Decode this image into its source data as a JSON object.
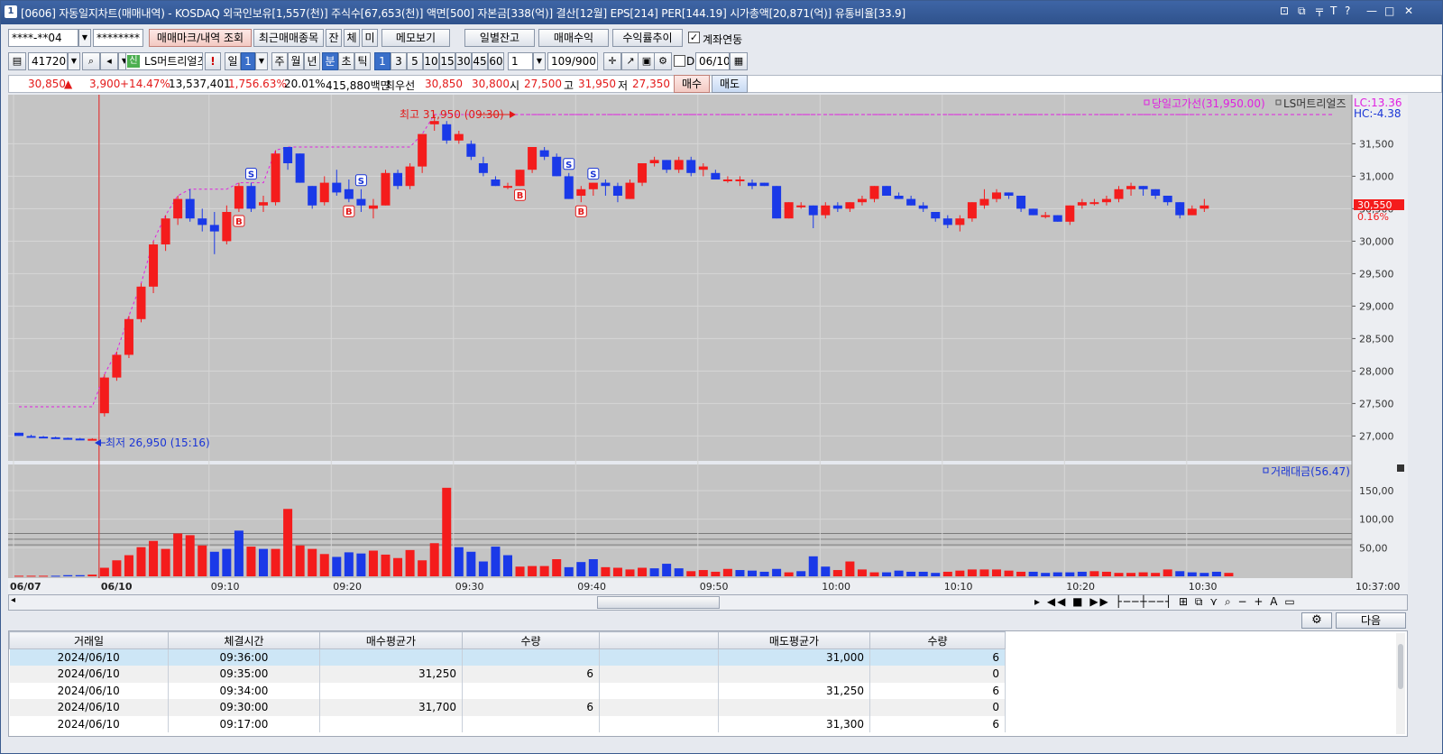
{
  "window": {
    "number": "1",
    "title": "[0606] 자동일지차트(매매내역) - KOSDAQ 외국인보유[1,557(천)] 주식수[67,653(천)] 액면[500] 자본금[338(억)] 결산[12월] EPS[214] PER[144.19] 시가총액[20,871(억)] 유통비율[33.9]",
    "controls": [
      "⊡",
      "⧉",
      "〒",
      "T",
      "?",
      "—",
      "□",
      "✕"
    ]
  },
  "toolbar1": {
    "account": "****-**04",
    "password": "********",
    "btn_trade_mark": "매매마크/내역 조회",
    "btn_recent": "최근매매종목",
    "btn_jan": "잔",
    "btn_che": "체",
    "btn_mi": "미",
    "btn_memo": "메모보기",
    "btn_daily_balance": "일별잔고",
    "btn_trade_profit": "매매수익",
    "btn_return_trend": "수익률추이",
    "account_link_label": "계좌연동"
  },
  "toolbar2": {
    "code": "417200",
    "badge": "신",
    "name": "LS머트리얼즈",
    "excl": "!",
    "period_label": "일",
    "period_value": "1",
    "periods": [
      "주",
      "월",
      "년",
      "분",
      "초",
      "틱"
    ],
    "intervals": [
      "1",
      "3",
      "5",
      "10",
      "15",
      "30",
      "45",
      "60"
    ],
    "custom_interval": "1",
    "count": "109/900",
    "date_checkbox": "D",
    "date": "06/10"
  },
  "info": {
    "price": "30,850",
    "arrow": "▲",
    "change": "3,900",
    "change_pct": "+14.47%",
    "volume": "13,537,401",
    "volume_pct": "1,756.63%",
    "turnover": "20.01%",
    "amount": "415,880백만",
    "quote_label": "최우선",
    "ask": "30,850",
    "bid": "30,800",
    "open_label": "시",
    "open": "27,500",
    "high_label": "고",
    "high": "31,950",
    "low_label": "저",
    "low": "27,350",
    "buy_btn": "매수",
    "sell_btn": "매도"
  },
  "chart_data": {
    "type": "candlestick",
    "price_axis": {
      "min": 26700,
      "max": 32200,
      "ticks": [
        27000,
        27500,
        28000,
        28500,
        29000,
        29500,
        30000,
        30500,
        31000,
        31500
      ]
    },
    "price_tick_labels": [
      "27,000",
      "27,500",
      "28,000",
      "28,500",
      "29,000",
      "29,500",
      "30,000",
      "30,500",
      "31,000",
      "31,500"
    ],
    "volume_axis": {
      "min": 0,
      "max": 180,
      "ticks": [
        50,
        100,
        150
      ]
    },
    "volume_tick_labels": [
      "50,00",
      "100,00",
      "150,00"
    ],
    "x_labels": [
      "06/07",
      "06/10",
      "09:10",
      "09:20",
      "09:30",
      "09:40",
      "09:50",
      "10:00",
      "10:10",
      "10:20",
      "10:30",
      "10:37:00"
    ],
    "annotations": {
      "high": "최고 31,950 (09:30)",
      "low": "최저 26,950 (15:16)",
      "prev_high_line": "당일고가선(31,950.00)",
      "series_name": "LS머트리얼즈",
      "lc": "LC:13.36",
      "hc": "HC:-4.38",
      "current_price": "30,550",
      "current_pct": "0.16%",
      "volume_series": "거래대금(56.47)"
    },
    "trade_marks": [
      "B",
      "S",
      "B",
      "S",
      "B",
      "S",
      "B",
      "S"
    ],
    "candles": [
      [
        27050,
        27050,
        27000,
        27000
      ],
      [
        27000,
        27020,
        26980,
        26990
      ],
      [
        26990,
        27000,
        26970,
        26980
      ],
      [
        26980,
        26990,
        26960,
        26970
      ],
      [
        26970,
        26975,
        26955,
        26960
      ],
      [
        26960,
        26970,
        26950,
        26955
      ],
      [
        26955,
        26965,
        26950,
        26955
      ],
      [
        27350,
        27950,
        27300,
        27900
      ],
      [
        27900,
        28300,
        27850,
        28250
      ],
      [
        28250,
        28850,
        28200,
        28800
      ],
      [
        28800,
        29350,
        28750,
        29300
      ],
      [
        29300,
        30000,
        29200,
        29950
      ],
      [
        29950,
        30400,
        29850,
        30350
      ],
      [
        30350,
        30700,
        30250,
        30650
      ],
      [
        30650,
        30800,
        30300,
        30350
      ],
      [
        30350,
        30500,
        30150,
        30250
      ],
      [
        30250,
        30450,
        29800,
        30150
      ],
      [
        30000,
        30550,
        29950,
        30450
      ],
      [
        30500,
        30900,
        30450,
        30850
      ],
      [
        30850,
        30900,
        30450,
        30500
      ],
      [
        30550,
        30700,
        30450,
        30600
      ],
      [
        30600,
        31400,
        30550,
        31350
      ],
      [
        31450,
        31450,
        31100,
        31200
      ],
      [
        31350,
        31350,
        30900,
        30900
      ],
      [
        30850,
        30850,
        30500,
        30550
      ],
      [
        30600,
        31000,
        30550,
        30900
      ],
      [
        30900,
        31100,
        30700,
        30750
      ],
      [
        30800,
        30950,
        30600,
        30650
      ],
      [
        30650,
        30800,
        30450,
        30550
      ],
      [
        30500,
        30650,
        30350,
        30550
      ],
      [
        30550,
        31100,
        30550,
        31050
      ],
      [
        31050,
        31100,
        30800,
        30850
      ],
      [
        30850,
        31200,
        30800,
        31150
      ],
      [
        31150,
        31650,
        31050,
        31650
      ],
      [
        31800,
        31950,
        31700,
        31850
      ],
      [
        31800,
        31850,
        31500,
        31550
      ],
      [
        31550,
        31700,
        31500,
        31650
      ],
      [
        31500,
        31550,
        31250,
        31300
      ],
      [
        31200,
        31300,
        31000,
        31050
      ],
      [
        30950,
        31000,
        30850,
        30850
      ],
      [
        30850,
        30900,
        30800,
        30850
      ],
      [
        30850,
        31100,
        30850,
        31100
      ],
      [
        31100,
        31450,
        31050,
        31450
      ],
      [
        31400,
        31450,
        31250,
        31300
      ],
      [
        31300,
        31350,
        31000,
        31000
      ],
      [
        31000,
        31050,
        30650,
        30650
      ],
      [
        30700,
        30850,
        30600,
        30800
      ],
      [
        30800,
        30900,
        30700,
        30900
      ],
      [
        30900,
        30950,
        30700,
        30850
      ],
      [
        30850,
        30900,
        30600,
        30700
      ],
      [
        30650,
        30950,
        30650,
        30900
      ],
      [
        30900,
        31200,
        30850,
        31200
      ],
      [
        31200,
        31300,
        31150,
        31250
      ],
      [
        31250,
        31250,
        31050,
        31100
      ],
      [
        31100,
        31300,
        31050,
        31250
      ],
      [
        31250,
        31300,
        31000,
        31050
      ],
      [
        31100,
        31200,
        31000,
        31150
      ],
      [
        31050,
        31100,
        30950,
        30950
      ],
      [
        30950,
        31000,
        30900,
        30950
      ],
      [
        30950,
        31000,
        30850,
        30950
      ],
      [
        30900,
        30950,
        30800,
        30850
      ],
      [
        30900,
        30900,
        30850,
        30850
      ],
      [
        30850,
        30850,
        30350,
        30350
      ],
      [
        30350,
        30600,
        30350,
        30600
      ],
      [
        30550,
        30600,
        30500,
        30550
      ],
      [
        30550,
        30550,
        30200,
        30400
      ],
      [
        30400,
        30600,
        30350,
        30550
      ],
      [
        30550,
        30600,
        30450,
        30500
      ],
      [
        30500,
        30600,
        30450,
        30600
      ],
      [
        30600,
        30700,
        30550,
        30650
      ],
      [
        30650,
        30850,
        30600,
        30850
      ],
      [
        30850,
        30850,
        30700,
        30700
      ],
      [
        30700,
        30750,
        30650,
        30650
      ],
      [
        30650,
        30700,
        30550,
        30550
      ],
      [
        30550,
        30600,
        30450,
        30500
      ],
      [
        30450,
        30450,
        30300,
        30350
      ],
      [
        30350,
        30400,
        30200,
        30250
      ],
      [
        30250,
        30400,
        30150,
        30350
      ],
      [
        30350,
        30600,
        30300,
        30600
      ],
      [
        30550,
        30800,
        30500,
        30650
      ],
      [
        30650,
        30800,
        30600,
        30750
      ],
      [
        30750,
        30750,
        30650,
        30700
      ],
      [
        30700,
        30700,
        30450,
        30500
      ],
      [
        30500,
        30500,
        30400,
        30400
      ],
      [
        30400,
        30450,
        30350,
        30400
      ],
      [
        30400,
        30400,
        30300,
        30300
      ],
      [
        30300,
        30550,
        30250,
        30550
      ],
      [
        30550,
        30650,
        30500,
        30600
      ],
      [
        30600,
        30650,
        30550,
        30600
      ],
      [
        30600,
        30700,
        30550,
        30650
      ],
      [
        30650,
        30850,
        30600,
        30800
      ],
      [
        30800,
        30900,
        30700,
        30850
      ],
      [
        30850,
        30850,
        30700,
        30800
      ],
      [
        30800,
        30800,
        30650,
        30700
      ],
      [
        30700,
        30700,
        30550,
        30600
      ],
      [
        30600,
        30600,
        30350,
        30400
      ],
      [
        30400,
        30550,
        30400,
        30500
      ],
      [
        30500,
        30650,
        30450,
        30550
      ]
    ],
    "volumes": [
      1,
      1,
      1,
      1,
      2,
      2,
      3,
      15,
      28,
      37,
      51,
      62,
      48,
      75,
      72,
      54,
      43,
      48,
      80,
      52,
      48,
      48,
      118,
      54,
      48,
      39,
      34,
      42,
      40,
      45,
      38,
      32,
      46,
      28,
      58,
      155,
      51,
      43,
      26,
      52,
      37,
      17,
      18,
      18,
      30,
      16,
      25,
      30,
      16,
      15,
      12,
      15,
      14,
      22,
      14,
      9,
      11,
      8,
      13,
      11,
      10,
      8,
      13,
      7,
      9,
      35,
      17,
      11,
      26,
      12,
      7,
      7,
      10,
      8,
      8,
      6,
      8,
      10,
      12,
      12,
      12,
      10,
      8,
      8,
      6,
      7,
      7,
      8,
      9,
      8,
      6,
      6,
      7,
      6,
      12,
      9,
      7,
      6,
      8,
      6
    ],
    "volume_colors": [
      "r",
      "r",
      "r",
      "b",
      "b",
      "b",
      "r",
      "r",
      "r",
      "r",
      "r",
      "r",
      "r",
      "r",
      "r",
      "r",
      "b",
      "b",
      "b",
      "r",
      "b",
      "r",
      "r",
      "r",
      "r",
      "r",
      "b",
      "b",
      "b",
      "r",
      "r",
      "r",
      "r",
      "r",
      "r",
      "r",
      "b",
      "b",
      "b",
      "b",
      "b",
      "r",
      "r",
      "r",
      "r",
      "b",
      "b",
      "b",
      "r",
      "r",
      "r",
      "r",
      "b",
      "b",
      "b",
      "r",
      "r",
      "r",
      "r",
      "b",
      "b",
      "b",
      "b",
      "r",
      "b",
      "b",
      "b",
      "r",
      "r",
      "r",
      "r",
      "b",
      "b",
      "b",
      "b",
      "b",
      "r",
      "r",
      "r",
      "r",
      "r",
      "r",
      "r",
      "b",
      "b",
      "b",
      "b",
      "b",
      "r",
      "r",
      "r",
      "r",
      "r",
      "r",
      "r",
      "b",
      "b",
      "b",
      "b",
      "r"
    ]
  },
  "table": {
    "headers": [
      "거래일",
      "체결시간",
      "매수평균가",
      "수량",
      "",
      "매도평균가",
      "수량"
    ],
    "rows": [
      [
        "2024/06/10",
        "09:36:00",
        "",
        "",
        "",
        "31,000",
        "6"
      ],
      [
        "2024/06/10",
        "09:35:00",
        "31,250",
        "6",
        "",
        "",
        "0"
      ],
      [
        "2024/06/10",
        "09:34:00",
        "",
        "",
        "",
        "31,250",
        "6"
      ],
      [
        "2024/06/10",
        "09:30:00",
        "31,700",
        "6",
        "",
        "",
        "0"
      ],
      [
        "2024/06/10",
        "09:17:00",
        "",
        "",
        "",
        "31,300",
        "6"
      ]
    ],
    "next_btn": "다음"
  },
  "colors": {
    "up": "#f41c1c",
    "down": "#1a39e8",
    "grid": "#d6d6d6",
    "chart_bg": "#c4c4c4",
    "magenta": "#e020e0"
  }
}
